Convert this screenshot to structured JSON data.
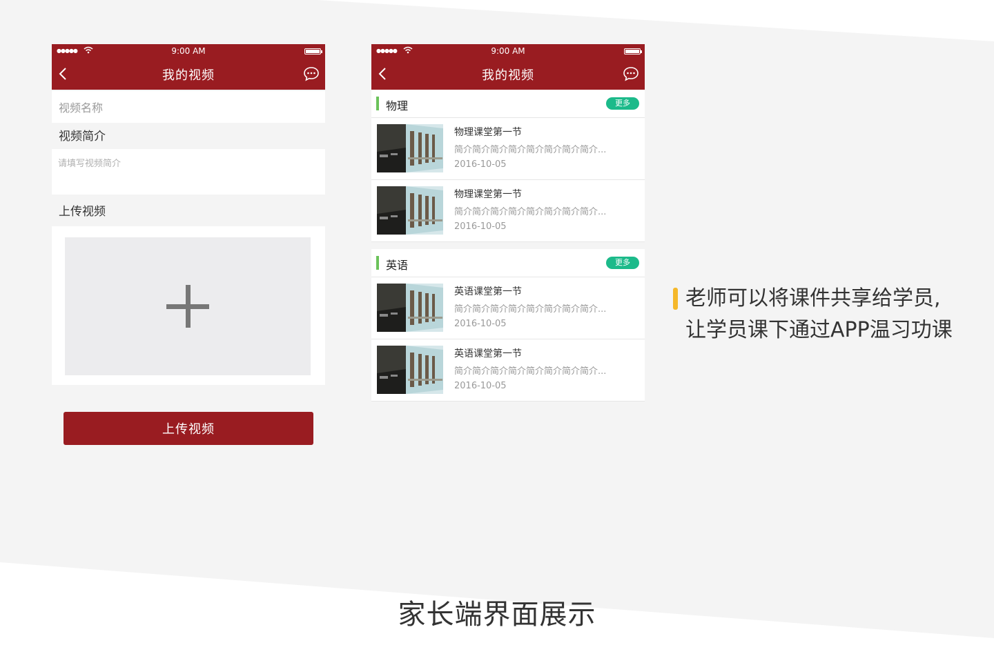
{
  "status_bar": {
    "time": "9:00 AM",
    "signal": "●●●●●"
  },
  "left_screen": {
    "title": "我的视频",
    "name_placeholder": "视频名称",
    "intro_label": "视频简介",
    "intro_placeholder": "请填写视频简介",
    "upload_label": "上传视频",
    "submit_label": "上传视频"
  },
  "right_screen": {
    "title": "我的视频",
    "groups": [
      {
        "name": "物理",
        "more": "更多",
        "items": [
          {
            "title": "物理课堂第一节",
            "desc": "简介简介简介简介简介简介简介简介...",
            "date": "2016-10-05"
          },
          {
            "title": "物理课堂第一节",
            "desc": "简介简介简介简介简介简介简介简介...",
            "date": "2016-10-05"
          }
        ]
      },
      {
        "name": "英语",
        "more": "更多",
        "items": [
          {
            "title": "英语课堂第一节",
            "desc": "简介简介简介简介简介简介简介简介...",
            "date": "2016-10-05"
          },
          {
            "title": "英语课堂第一节",
            "desc": "简介简介简介简介简介简介简介简介...",
            "date": "2016-10-05"
          }
        ]
      }
    ]
  },
  "caption": {
    "line1": "老师可以将课件共享给学员,",
    "line2": "让学员课下通过APP温习功课"
  },
  "footer_title": "家长端界面展示",
  "colors": {
    "brand": "#991c21",
    "more_badge": "#1cba8a",
    "group_bar": "#6bc25a",
    "caption_bar": "#f5b82a"
  }
}
